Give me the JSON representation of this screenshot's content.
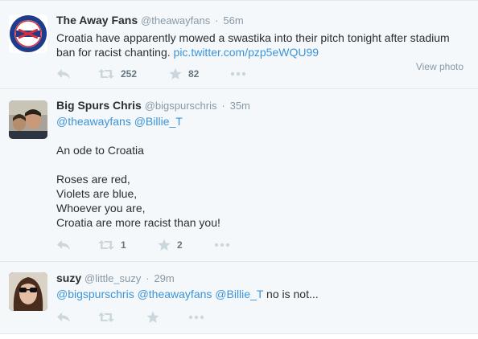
{
  "tweets": [
    {
      "name": "The Away Fans",
      "handle": "@theawayfans",
      "time": "56m",
      "line1": "Croatia have apparently mowed a swastika into their pitch tonight after stadium",
      "line2_text": "ban for racist chanting. ",
      "line2_link": "pic.twitter.com/pzp5eWQU99",
      "view_photo": "View photo",
      "retweets": "252",
      "favorites": "82",
      "avatar_logo_text": "THE AWAY FANS · FOR FANS"
    },
    {
      "name": "Big Spurs Chris",
      "handle": "@bigspurschris",
      "time": "35m",
      "mentions": "@theawayfans @Billie_T",
      "lines": [
        "An ode to Croatia",
        "Roses are red,",
        "Violets are blue,",
        "Whoever you are,",
        "Croatia are more racist than you!"
      ],
      "retweets": "1",
      "favorites": "2"
    },
    {
      "name": "suzy",
      "handle": "@little_suzy",
      "time": "29m",
      "mentions": "@bigspurschris @theawayfans @Billie_T",
      "text": " no is not...",
      "retweets": "",
      "favorites": ""
    }
  ],
  "icons": [
    "reply-icon",
    "retweet-icon",
    "favorite-icon",
    "more-icon"
  ],
  "colors": {
    "link": "#3b94d9",
    "muted": "#8899a6",
    "background": "#f5f8fa",
    "logo_red": "#d32f3a",
    "logo_blue": "#1e3c8c"
  }
}
